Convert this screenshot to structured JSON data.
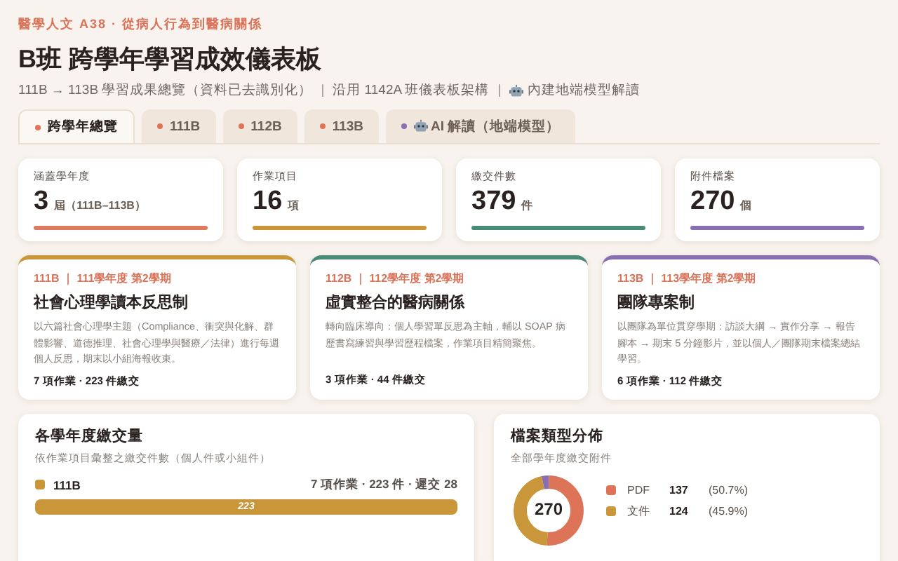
{
  "header": {
    "eyebrow": "醫學人文 A38 · 從病人行為到醫病關係",
    "title": "B班 跨學年學習成效儀表板",
    "subtitle": [
      {
        "kind": "text",
        "text": "111B → 113B 學習成果總覽（資料已去識別化）"
      },
      {
        "kind": "separator",
        "text": "|"
      },
      {
        "kind": "text",
        "text": "沿用 1142A 班儀表板架構"
      },
      {
        "kind": "separator",
        "text": "|"
      },
      {
        "kind": "robot",
        "text": "內建地端模型解讀"
      }
    ]
  },
  "tabs": [
    {
      "label": "跨學年總覽",
      "selected": true,
      "color": "#dd7458",
      "icon": false
    },
    {
      "label": "111B",
      "selected": false,
      "color": "#dd7458",
      "icon": false
    },
    {
      "label": "112B",
      "selected": false,
      "color": "#dd7458",
      "icon": false
    },
    {
      "label": "113B",
      "selected": false,
      "color": "#dd7458",
      "icon": false
    },
    {
      "label": "AI 解讀（地端模型）",
      "selected": false,
      "color": "#8a6fb0",
      "icon": true
    }
  ],
  "stats": [
    {
      "label": "涵蓋學年度",
      "value": "3",
      "unit": "屆（111B–113B）",
      "color": "#de7a5f"
    },
    {
      "label": "作業項目",
      "value": "16",
      "unit": "項",
      "color": "#c9973a"
    },
    {
      "label": "繳交件數",
      "value": "379",
      "unit": "件",
      "color": "#4a8a78"
    },
    {
      "label": "附件檔案",
      "value": "270",
      "unit": "個",
      "color": "#8a6fb0"
    }
  ],
  "semesters": [
    {
      "tag": "111B ｜ 111學年度 第2學期",
      "title": "社會心理學讀本反思制",
      "desc": "以六篇社會心理學主題（Compliance、衝突與化解、群體影響、道德推理、社會心理學與醫療／法律）進行每週個人反思，期末以小組海報收束。",
      "footer": "7 項作業 · 223 件繳交",
      "color": "#c9973a"
    },
    {
      "tag": "112B ｜ 112學年度 第2學期",
      "title": "虛實整合的醫病關係",
      "desc": "轉向臨床導向：個人學習單反思為主軸，輔以 SOAP 病歷書寫練習與學習歷程檔案，作業項目精簡聚焦。",
      "footer": "3 項作業 · 44 件繳交",
      "color": "#4a8a78"
    },
    {
      "tag": "113B ｜ 113學年度 第2學期",
      "title": "團隊專案制",
      "desc": "以團隊為單位貫穿學期：訪談大綱 → 實作分享 → 報告腳本 → 期末 5 分鐘影片，並以個人／團隊期末檔案總結學習。",
      "footer": "6 項作業 · 112 件繳交",
      "color": "#8a6fb0"
    }
  ],
  "volume": {
    "title": "各學年度繳交量",
    "subtitle": "依作業項目彙整之繳交件數（個人件或小組件）",
    "rows": [
      {
        "name": "111B",
        "summary": "7 項作業 · 223 件 · 遲交 28",
        "bar_label": "223",
        "level": 1.0,
        "color": "#c9973a"
      }
    ]
  },
  "files": {
    "title": "檔案類型分佈",
    "subtitle": "全部學年度繳交附件",
    "total": "270",
    "legend": [
      {
        "name": "PDF",
        "count": "137",
        "pct": "(50.7%)",
        "color": "#dd7458"
      },
      {
        "name": "文件",
        "count": "124",
        "pct": "(45.9%)",
        "color": "#c9973a"
      }
    ]
  }
}
